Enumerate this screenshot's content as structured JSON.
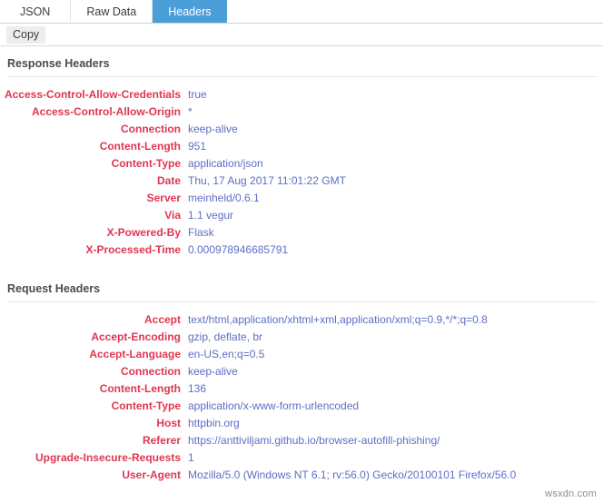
{
  "tabs": [
    {
      "label": "JSON",
      "active": false
    },
    {
      "label": "Raw Data",
      "active": false
    },
    {
      "label": "Headers",
      "active": true
    }
  ],
  "toolbar": {
    "copy_label": "Copy"
  },
  "colors": {
    "tab_active_bg": "#4c9ed9",
    "tab_active_text": "#ffffff",
    "header_name": "#e03651",
    "header_value": "#5f6ec4",
    "section_title": "#4a4b4d",
    "divider": "#e7e8ea",
    "page_bg": "#ffffff"
  },
  "sections": [
    {
      "title": "Response Headers",
      "rows": [
        {
          "name": "Access-Control-Allow-Credentials",
          "value": "true"
        },
        {
          "name": "Access-Control-Allow-Origin",
          "value": "*"
        },
        {
          "name": "Connection",
          "value": "keep-alive"
        },
        {
          "name": "Content-Length",
          "value": "951"
        },
        {
          "name": "Content-Type",
          "value": "application/json"
        },
        {
          "name": "Date",
          "value": "Thu, 17 Aug 2017 11:01:22 GMT"
        },
        {
          "name": "Server",
          "value": "meinheld/0.6.1"
        },
        {
          "name": "Via",
          "value": "1.1 vegur"
        },
        {
          "name": "X-Powered-By",
          "value": "Flask"
        },
        {
          "name": "X-Processed-Time",
          "value": "0.000978946685791"
        }
      ]
    },
    {
      "title": "Request Headers",
      "rows": [
        {
          "name": "Accept",
          "value": "text/html,application/xhtml+xml,application/xml;q=0.9,*/*;q=0.8"
        },
        {
          "name": "Accept-Encoding",
          "value": "gzip, deflate, br"
        },
        {
          "name": "Accept-Language",
          "value": "en-US,en;q=0.5"
        },
        {
          "name": "Connection",
          "value": "keep-alive"
        },
        {
          "name": "Content-Length",
          "value": "136"
        },
        {
          "name": "Content-Type",
          "value": "application/x-www-form-urlencoded"
        },
        {
          "name": "Host",
          "value": "httpbin.org"
        },
        {
          "name": "Referer",
          "value": "https://anttiviljami.github.io/browser-autofill-phishing/"
        },
        {
          "name": "Upgrade-Insecure-Requests",
          "value": "1"
        },
        {
          "name": "User-Agent",
          "value": "Mozilla/5.0 (Windows NT 6.1; rv:56.0) Gecko/20100101 Firefox/56.0"
        }
      ]
    }
  ],
  "watermark": {
    "text": "wsxdn.com"
  }
}
